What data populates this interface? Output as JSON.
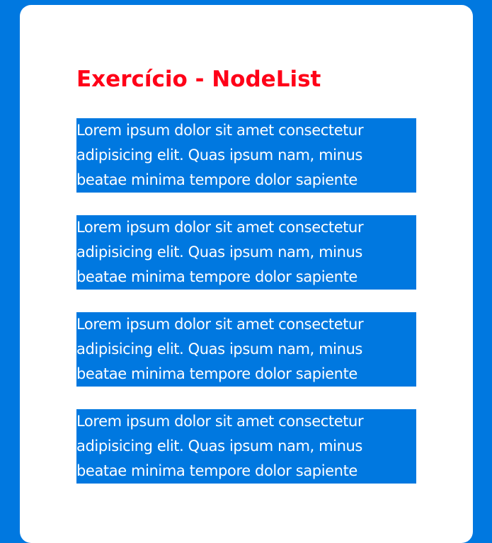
{
  "page": {
    "title": "Exercício - NodeList",
    "paragraphs": [
      "Lorem ipsum dolor sit amet consectetur\nadipisicing elit. Quas ipsum nam, minus\nbeatae minima tempore dolor sapiente",
      "Lorem ipsum dolor sit amet consectetur\nadipisicing elit. Quas ipsum nam, minus\nbeatae minima tempore dolor sapiente",
      "Lorem ipsum dolor sit amet consectetur\nadipisicing elit. Quas ipsum nam, minus\nbeatae minima tempore dolor sapiente",
      "Lorem ipsum dolor sit amet consectetur\nadipisicing elit. Quas ipsum nam, minus\nbeatae minima tempore dolor sapiente"
    ]
  },
  "colors": {
    "background": "#0078e0",
    "card": "#ffffff",
    "title": "#ff0018",
    "paragraph_bg": "#0078e0",
    "paragraph_text": "#ffffff"
  }
}
